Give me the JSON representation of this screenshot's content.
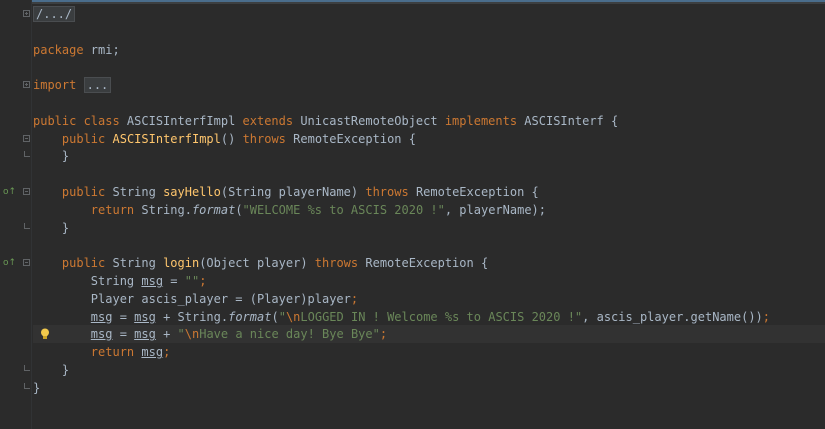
{
  "editor": {
    "language": "java",
    "lines": [
      [
        {
          "t": "/.../",
          "c": "collapsed"
        }
      ],
      [],
      [
        {
          "t": "package",
          "c": "kw"
        },
        {
          "t": " rmi;",
          "c": ""
        }
      ],
      [],
      [
        {
          "t": "import",
          "c": "kw"
        },
        {
          "t": " ",
          "c": ""
        },
        {
          "t": "...",
          "c": "collapsed"
        }
      ],
      [],
      [
        {
          "t": "public class",
          "c": "kw"
        },
        {
          "t": " ASCISInterfImpl ",
          "c": ""
        },
        {
          "t": "extends",
          "c": "kw"
        },
        {
          "t": " UnicastRemoteObject ",
          "c": ""
        },
        {
          "t": "implements",
          "c": "kw"
        },
        {
          "t": " ASCISInterf {",
          "c": ""
        }
      ],
      [
        {
          "t": "    ",
          "c": ""
        },
        {
          "t": "public",
          "c": "kw"
        },
        {
          "t": " ",
          "c": ""
        },
        {
          "t": "ASCISInterfImpl",
          "c": "fn"
        },
        {
          "t": "() ",
          "c": ""
        },
        {
          "t": "throws",
          "c": "kw"
        },
        {
          "t": " RemoteException {",
          "c": ""
        }
      ],
      [
        {
          "t": "    }",
          "c": ""
        }
      ],
      [],
      [
        {
          "t": "    ",
          "c": ""
        },
        {
          "t": "public",
          "c": "kw"
        },
        {
          "t": " String ",
          "c": ""
        },
        {
          "t": "sayHello",
          "c": "fn"
        },
        {
          "t": "(String playerName) ",
          "c": ""
        },
        {
          "t": "throws",
          "c": "kw"
        },
        {
          "t": " RemoteException {",
          "c": ""
        }
      ],
      [
        {
          "t": "        ",
          "c": ""
        },
        {
          "t": "return",
          "c": "kw"
        },
        {
          "t": " String.",
          "c": ""
        },
        {
          "t": "format",
          "c": "it"
        },
        {
          "t": "(",
          "c": ""
        },
        {
          "t": "\"WELCOME %s to ASCIS 2020 !\"",
          "c": "str"
        },
        {
          "t": ", playerName);",
          "c": ""
        }
      ],
      [
        {
          "t": "    }",
          "c": ""
        }
      ],
      [],
      [
        {
          "t": "    ",
          "c": ""
        },
        {
          "t": "public",
          "c": "kw"
        },
        {
          "t": " String ",
          "c": ""
        },
        {
          "t": "login",
          "c": "fn"
        },
        {
          "t": "(Object player) ",
          "c": ""
        },
        {
          "t": "throws",
          "c": "kw"
        },
        {
          "t": " RemoteException {",
          "c": ""
        }
      ],
      [
        {
          "t": "        String ",
          "c": ""
        },
        {
          "t": "msg",
          "c": "ul"
        },
        {
          "t": " = ",
          "c": ""
        },
        {
          "t": "\"\"",
          "c": "str"
        },
        {
          "t": ";",
          "c": "kw"
        }
      ],
      [
        {
          "t": "        Player ascis_player = (Player)player",
          "c": ""
        },
        {
          "t": ";",
          "c": "kw"
        }
      ],
      [
        {
          "t": "        ",
          "c": ""
        },
        {
          "t": "msg",
          "c": "ul"
        },
        {
          "t": " = ",
          "c": ""
        },
        {
          "t": "msg",
          "c": "ul"
        },
        {
          "t": " + String.",
          "c": ""
        },
        {
          "t": "format",
          "c": "it"
        },
        {
          "t": "(",
          "c": ""
        },
        {
          "t": "\"",
          "c": "str"
        },
        {
          "t": "\\n",
          "c": "esc"
        },
        {
          "t": "LOGGED IN ! Welcome %s to ASCIS 2020 !\"",
          "c": "str"
        },
        {
          "t": ", ascis_player.getName())",
          "c": ""
        },
        {
          "t": ";",
          "c": "kw"
        }
      ],
      [
        {
          "t": "        ",
          "c": ""
        },
        {
          "t": "msg",
          "c": "ul"
        },
        {
          "t": " = ",
          "c": ""
        },
        {
          "t": "msg",
          "c": "ul"
        },
        {
          "t": " + ",
          "c": ""
        },
        {
          "t": "\"",
          "c": "str"
        },
        {
          "t": "\\n",
          "c": "esc"
        },
        {
          "t": "Have a nice day! Bye Bye\"",
          "c": "str"
        },
        {
          "t": ";",
          "c": "kw"
        }
      ],
      [
        {
          "t": "        ",
          "c": ""
        },
        {
          "t": "return",
          "c": "kw"
        },
        {
          "t": " ",
          "c": ""
        },
        {
          "t": "msg",
          "c": "ul"
        },
        {
          "t": ";",
          "c": "kw"
        }
      ],
      [
        {
          "t": "    }",
          "c": ""
        }
      ],
      [
        {
          "t": "}",
          "c": ""
        }
      ]
    ],
    "caret_line_index": 18
  },
  "gutter": {
    "fold_markers": [
      {
        "line": 0,
        "kind": "plus"
      },
      {
        "line": 4,
        "kind": "plus"
      },
      {
        "line": 7,
        "kind": "minus"
      },
      {
        "line": 8,
        "kind": "end"
      },
      {
        "line": 10,
        "kind": "minus"
      },
      {
        "line": 12,
        "kind": "end"
      },
      {
        "line": 14,
        "kind": "minus"
      },
      {
        "line": 20,
        "kind": "end"
      },
      {
        "line": 21,
        "kind": "end"
      }
    ],
    "override_markers": [
      {
        "line": 10,
        "icon": "override-implements-icon",
        "glyph": "o↑"
      },
      {
        "line": 14,
        "icon": "override-implements-icon",
        "glyph": "o↑"
      }
    ],
    "intention_bulb": {
      "line": 18,
      "icon": "lightbulb-icon"
    }
  },
  "colors": {
    "background": "#2b2b2b",
    "keyword": "#cc7832",
    "method": "#ffc66d",
    "string": "#6a8759",
    "text": "#a9b7c6",
    "caret_line": "#323232"
  }
}
